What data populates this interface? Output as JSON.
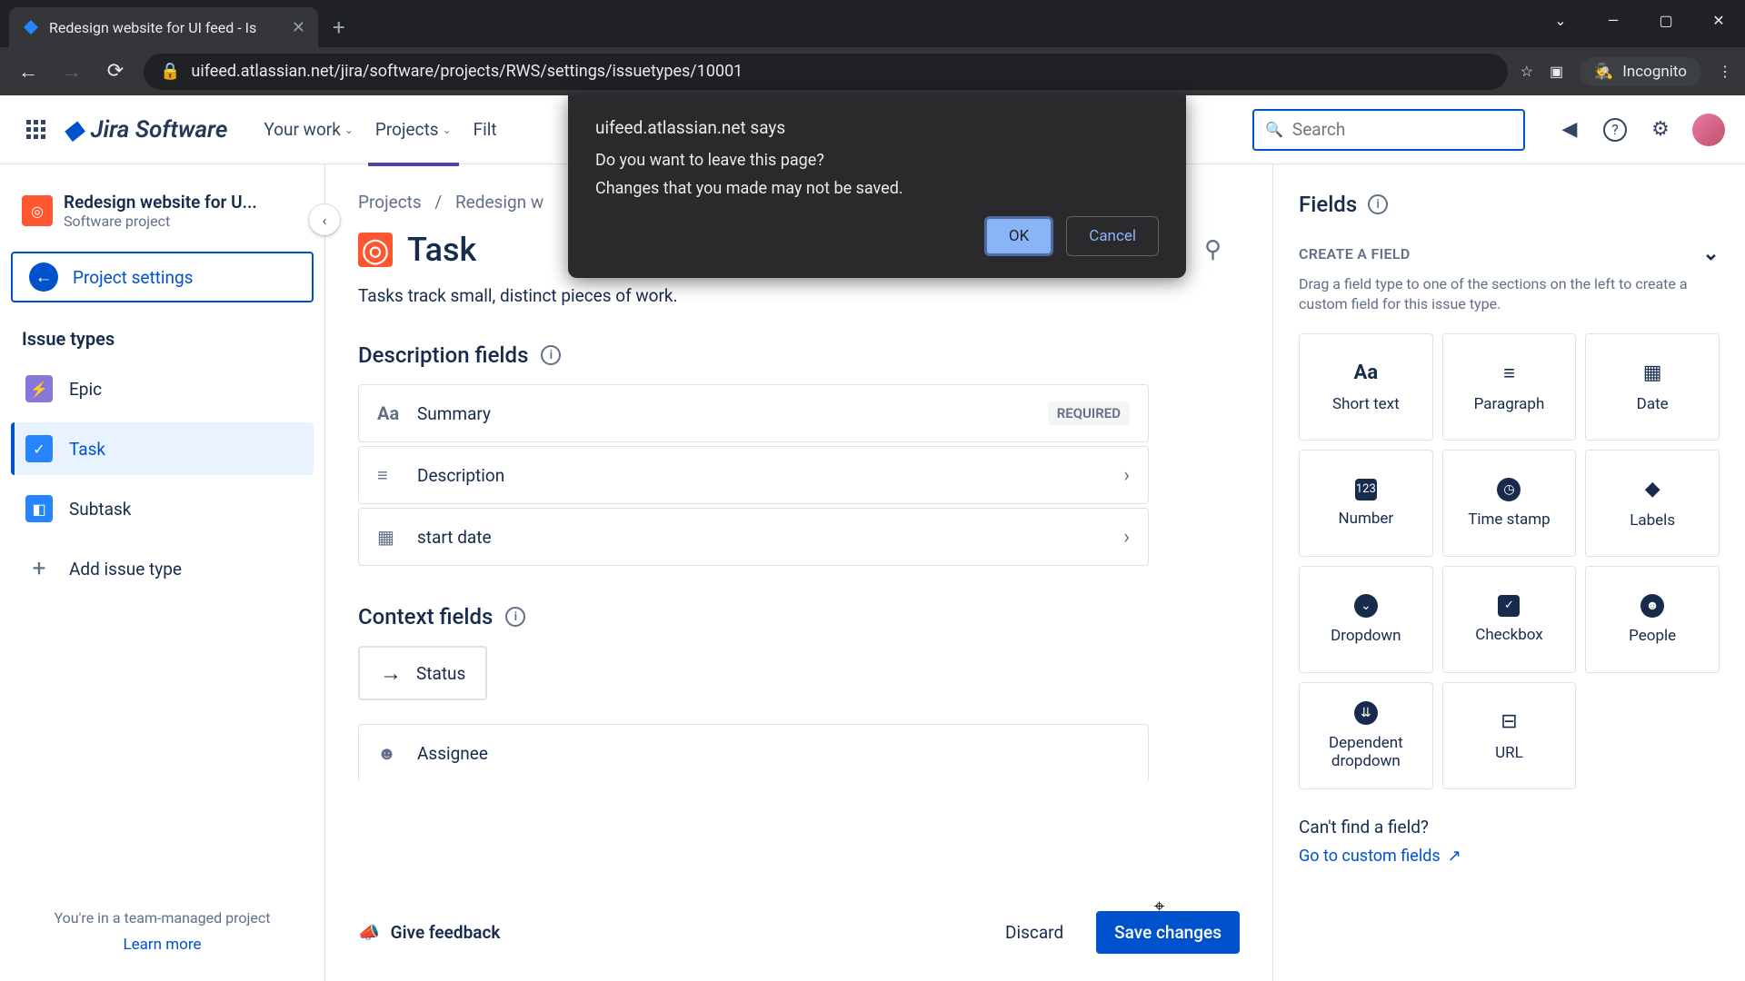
{
  "browser": {
    "tab_title": "Redesign website for UI feed - Is",
    "url": "uifeed.atlassian.net/jira/software/projects/RWS/settings/issuetypes/10001",
    "incognito_label": "Incognito"
  },
  "topnav": {
    "logo": "Jira Software",
    "items": [
      {
        "label": "Your work"
      },
      {
        "label": "Projects"
      },
      {
        "label": "Filt"
      }
    ],
    "search_placeholder": "Search"
  },
  "sidebar": {
    "project_name": "Redesign website for U...",
    "project_sub": "Software project",
    "settings_label": "Project settings",
    "section": "Issue types",
    "items": [
      {
        "label": "Epic",
        "kind": "epic"
      },
      {
        "label": "Task",
        "kind": "task",
        "selected": true
      },
      {
        "label": "Subtask",
        "kind": "subtask"
      }
    ],
    "add_label": "Add issue type",
    "footer_text": "You're in a team-managed project",
    "footer_link": "Learn more"
  },
  "content": {
    "breadcrumb": {
      "a": "Projects",
      "b": "Redesign w"
    },
    "title": "Task",
    "desc": "Tasks track small, distinct pieces of work.",
    "section_desc": "Description fields",
    "section_ctx": "Context fields",
    "fields_desc": [
      {
        "label": "Summary",
        "icon": "Aa",
        "required": true
      },
      {
        "label": "Description",
        "icon": "≡"
      },
      {
        "label": "start date",
        "icon": "▦"
      }
    ],
    "status_label": "Status",
    "assignee_label": "Assignee",
    "required_badge": "REQUIRED",
    "feedback": "Give feedback",
    "discard": "Discard",
    "save": "Save changes"
  },
  "right": {
    "title": "Fields",
    "section": "CREATE A FIELD",
    "hint": "Drag a field type to one of the sections on the left to create a custom field for this issue type.",
    "cards": [
      {
        "label": "Short text",
        "icon": "Aa"
      },
      {
        "label": "Paragraph",
        "icon": "≡"
      },
      {
        "label": "Date",
        "icon": "▦"
      },
      {
        "label": "Number",
        "icon": "123"
      },
      {
        "label": "Time stamp",
        "icon": "◷"
      },
      {
        "label": "Labels",
        "icon": "◆"
      },
      {
        "label": "Dropdown",
        "icon": "⌄"
      },
      {
        "label": "Checkbox",
        "icon": "✓"
      },
      {
        "label": "People",
        "icon": "☻"
      },
      {
        "label": "Dependent dropdown",
        "icon": "⌄⌄"
      },
      {
        "label": "URL",
        "icon": "⊟"
      }
    ],
    "cant_find": "Can't find a field?",
    "custom_link": "Go to custom fields"
  },
  "dialog": {
    "host": "uifeed.atlassian.net says",
    "line1": "Do you want to leave this page?",
    "line2": "Changes that you made may not be saved.",
    "ok": "OK",
    "cancel": "Cancel"
  }
}
